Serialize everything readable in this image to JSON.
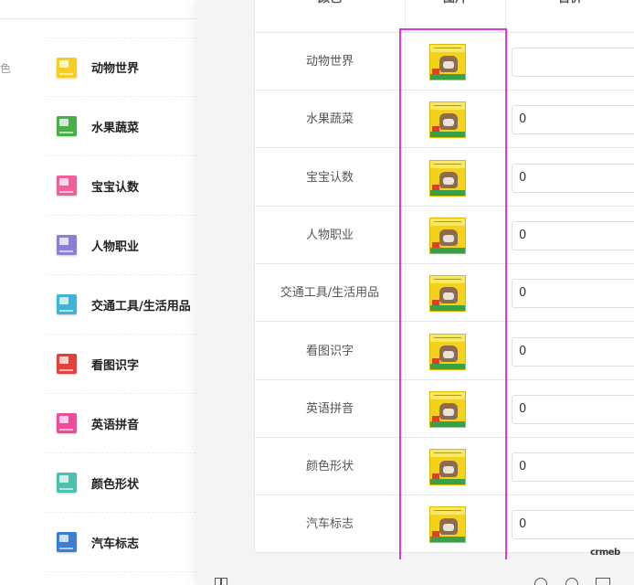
{
  "left_list": {
    "fragment_label": "色",
    "items": [
      {
        "label": "动物世界",
        "icon": "book-cover-icon",
        "color": "#f4cf20"
      },
      {
        "label": "水果蔬菜",
        "icon": "book-cover-icon",
        "color": "#4cae4a"
      },
      {
        "label": "宝宝认数",
        "icon": "book-cover-icon",
        "color": "#ef5f9b"
      },
      {
        "label": "人物职业",
        "icon": "book-cover-icon",
        "color": "#8a7fd0"
      },
      {
        "label": "交通工具/生活用品",
        "icon": "book-cover-icon",
        "color": "#3fb3d8"
      },
      {
        "label": "看图识字",
        "icon": "book-cover-icon",
        "color": "#e2413c"
      },
      {
        "label": "英语拼音",
        "icon": "book-cover-icon",
        "color": "#ee4c9a"
      },
      {
        "label": "颜色形状",
        "icon": "book-cover-icon",
        "color": "#4cbfae"
      },
      {
        "label": "汽车标志",
        "icon": "book-cover-icon",
        "color": "#3c7fd1"
      }
    ]
  },
  "table": {
    "headers": {
      "name": "颜色",
      "image": "图片",
      "price": "售价"
    },
    "rows": [
      {
        "name": "动物世界",
        "price": ""
      },
      {
        "name": "水果蔬菜",
        "price": "0"
      },
      {
        "name": "宝宝认数",
        "price": "0"
      },
      {
        "name": "人物职业",
        "price": "0"
      },
      {
        "name": "交通工具/生活用品",
        "price": "0"
      },
      {
        "name": "看图识字",
        "price": "0"
      },
      {
        "name": "英语拼音",
        "price": "0"
      },
      {
        "name": "颜色形状",
        "price": "0"
      },
      {
        "name": "汽车标志",
        "price": "0"
      }
    ]
  },
  "highlight_color": "#e532e5",
  "watermark": "crmeb"
}
